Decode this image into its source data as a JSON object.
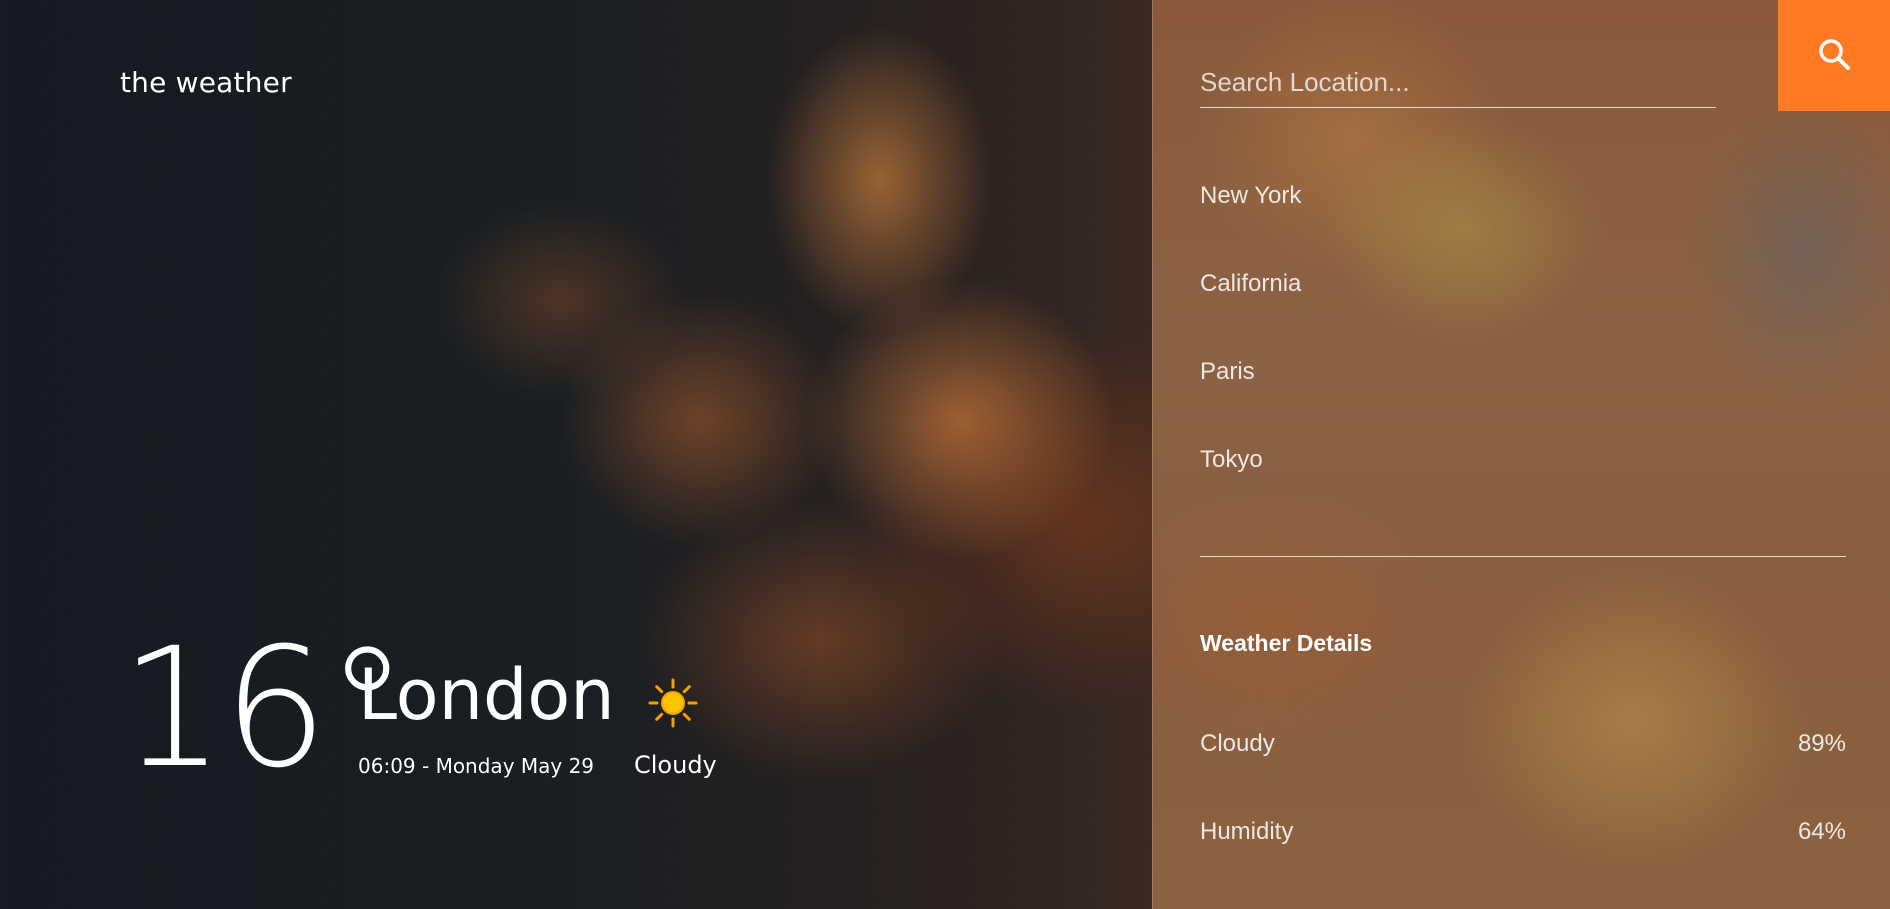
{
  "brand": "the weather",
  "current": {
    "temperature": "16°",
    "city": "London",
    "datetime": "06:09 - Monday May 29",
    "condition": "Cloudy",
    "icon": "sun-icon"
  },
  "search": {
    "placeholder": "Search Location...",
    "icon": "search-icon",
    "accent_color": "#ff7a22"
  },
  "locations": [
    "New York",
    "California",
    "Paris",
    "Tokyo"
  ],
  "details": {
    "title": "Weather Details",
    "rows": [
      {
        "label": "Cloudy",
        "value": "89%"
      },
      {
        "label": "Humidity",
        "value": "64%"
      }
    ]
  }
}
